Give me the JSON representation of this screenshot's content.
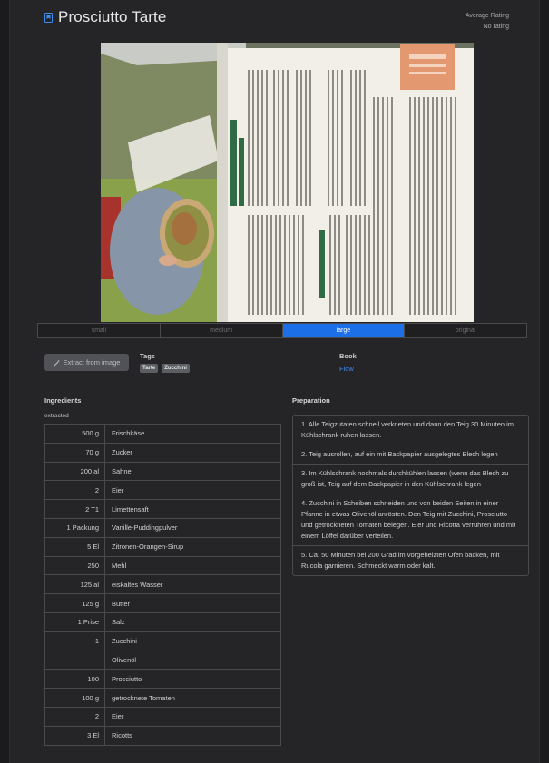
{
  "recipe": {
    "title": "Prosciutto Tarte",
    "rating_label": "Average Rating",
    "rating_value": "No rating"
  },
  "image_sizes": [
    "small",
    "medium",
    "large",
    "original"
  ],
  "image_size_active": "large",
  "actions": {
    "extract_label": "Extract from image"
  },
  "tags": {
    "label": "Tags",
    "items": [
      "Tarte",
      "Zucchini"
    ]
  },
  "book": {
    "label": "Book",
    "value": "Flow"
  },
  "ingredients": {
    "title": "Ingredients",
    "subtitle": "extracted",
    "rows": [
      {
        "amount": "500 g",
        "name": "Frischkäse"
      },
      {
        "amount": "70 g",
        "name": "Zucker"
      },
      {
        "amount": "200 al",
        "name": "Sahne"
      },
      {
        "amount": "2",
        "name": "Eier"
      },
      {
        "amount": "2 T1",
        "name": "Limettensaft"
      },
      {
        "amount": "1 Packung",
        "name": "Vanille-Puddingpulver"
      },
      {
        "amount": "5 El",
        "name": "Zitronen-Orangen-Sirup"
      },
      {
        "amount": "250",
        "name": "Mehl"
      },
      {
        "amount": "125 al",
        "name": "eiskaltes Wasser"
      },
      {
        "amount": "125 g",
        "name": "Butter"
      },
      {
        "amount": "1 Prise",
        "name": "Salz"
      },
      {
        "amount": "1",
        "name": "Zucchini"
      },
      {
        "amount": "",
        "name": "Olivenöl"
      },
      {
        "amount": "100",
        "name": "Prosciutto"
      },
      {
        "amount": "100 g",
        "name": "getrocknete Tomaten"
      },
      {
        "amount": "2",
        "name": "Eier"
      },
      {
        "amount": "3 El",
        "name": "Ricotts"
      }
    ]
  },
  "preparation": {
    "title": "Preparation",
    "steps": [
      "1. Alle Teigzutaten schnell verkneten und dann den Teig 30 Minuten im Kühlschrank ruhen lassen.",
      "2. Teig ausrollen, auf ein mit Backpapier ausgelegtes Blech legen",
      "3. Im Kühlschrank nochmals durchkühlen lassen (wenn das Blech zu groß ist, Teig auf dem Backpapier in den Kühlschrank legen",
      "4. Zucchini in Scheiben schneiden und von beiden Seiten in einer Pfanne in etwas Olivenöl anrösten. Den Teig mit Zucchini, Prosciutto und getrockneten Tomaten belegen. Eier und Ricotta verrühren und mit einem Löffel darüber verteilen.",
      "5. Ca. 50 Minuten bei 200 Grad im vorgeheizten Ofen backen, mit Rucola garnieren. Schmeckt warm oder kalt."
    ]
  },
  "colors": {
    "background": "#1b1b1d",
    "panel": "#252527",
    "accent": "#1d6fe8",
    "link": "#3f8cf0",
    "border": "#4a4a4e"
  },
  "icons": {
    "bookmark": "bookmark-icon",
    "extract": "magic-wand-icon",
    "photo": "recipe-photo"
  }
}
